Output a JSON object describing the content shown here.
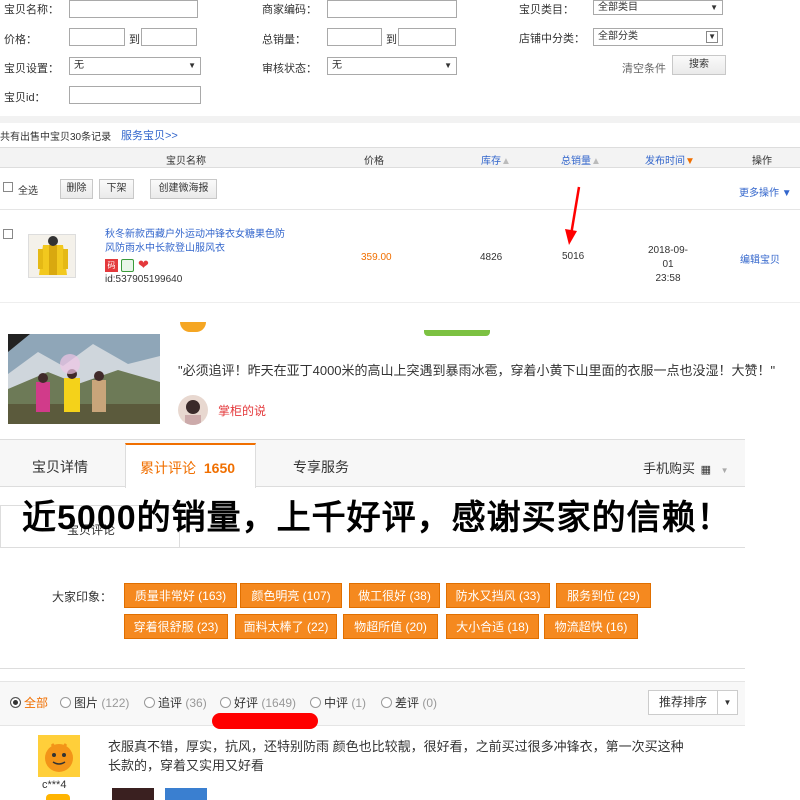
{
  "filters": {
    "item_name_label": "宝贝名称：",
    "merchant_code_label": "商家编码：",
    "category_label": "宝贝类目：",
    "category_value": "全部类目",
    "price_label": "价格：",
    "to_label": "到",
    "total_sales_label": "总销量：",
    "shop_category_label": "店铺中分类：",
    "shop_category_value": "全部分类",
    "item_setting_label": "宝贝设置：",
    "item_setting_value": "无",
    "audit_status_label": "审核状态：",
    "audit_status_value": "无",
    "clear_label": "清空条件",
    "search_label": "搜索",
    "item_id_label": "宝贝id："
  },
  "summary": {
    "text": "共有出售中宝贝30条记录",
    "service_link": "服务宝贝>>"
  },
  "table": {
    "headers": {
      "name": "宝贝名称",
      "price": "价格",
      "stock": "库存",
      "sales": "总销量",
      "publish_time": "发布时间",
      "action": "操作"
    },
    "toolbar": {
      "select_all": "全选",
      "delete": "删除",
      "delist": "下架",
      "create_poster": "创建微海报",
      "more_actions": "更多操作"
    },
    "row": {
      "title_line1": "秋冬新款西藏户外运动冲锋衣女糖果色防",
      "title_line2": "风防雨水中长款登山服风衣",
      "badge_label": "码",
      "id_text": "id:537905199640",
      "price": "359.00",
      "stock": "4826",
      "sales": "5016",
      "date": "2018-09-01",
      "time": "23:58",
      "edit_action": "编辑宝贝"
    }
  },
  "review_banner": {
    "quote": "\"必须追评！昨天在亚丁4000米的高山上突遇到暴雨冰雹，穿着小黄下山里面的衣服一点也没湿！大赞！\"",
    "shopkeeper_says": "掌柜的说"
  },
  "tabs": {
    "detail": "宝贝详情",
    "reviews_label": "累计评论",
    "reviews_count": "1650",
    "exclusive_service": "专享服务",
    "mobile_buy": "手机购买"
  },
  "overlay_caption": "近5000的销量，上千好评，感谢买家的信赖！",
  "subtab": {
    "item_reviews": "宝贝评论"
  },
  "impressions": {
    "label": "大家印象：",
    "tags": [
      "质量非常好 (163)",
      "颜色明亮 (107)",
      "做工很好 (38)",
      "防水又挡风 (33)",
      "服务到位 (29)",
      "穿着很舒服 (23)",
      "面料太棒了 (22)",
      "物超所值 (20)",
      "大小合适 (18)",
      "物流超快 (16)"
    ]
  },
  "filter_bar": {
    "all": "全部",
    "photos": "图片",
    "photos_count": "(122)",
    "followup": "追评",
    "followup_count": "(36)",
    "good": "好评",
    "good_count": "(1649)",
    "neutral": "中评",
    "neutral_count": "(1)",
    "bad": "差评",
    "bad_count": "(0)",
    "sort": "推荐排序"
  },
  "review": {
    "user": "c***4",
    "text_line1": "衣服真不错，厚实，抗风，还特别防雨 颜色也比较靓，很好看，之前买过很多冲锋衣，第一次买这种",
    "text_line2": "长款的，穿着又实用又好看"
  },
  "colors": {
    "accent_orange": "#f06f00",
    "tag_orange": "#f5891f",
    "link_blue": "#3366cc",
    "annotation_red": "#ff0000"
  }
}
